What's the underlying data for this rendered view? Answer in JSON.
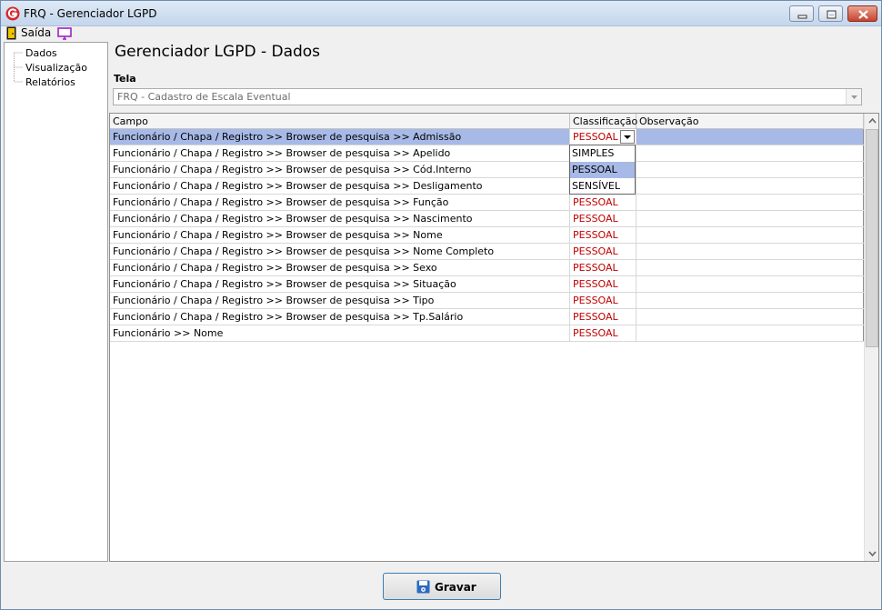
{
  "window": {
    "title": "FRQ - Gerenciador LGPD"
  },
  "menu": {
    "exit_label": "Saída"
  },
  "sidebar": {
    "items": [
      {
        "label": "Dados"
      },
      {
        "label": "Visualização"
      },
      {
        "label": "Relatórios"
      }
    ]
  },
  "page": {
    "title": "Gerenciador LGPD - Dados"
  },
  "tela": {
    "label": "Tela",
    "value": "FRQ - Cadastro de Escala Eventual"
  },
  "grid": {
    "columns": [
      "Campo",
      "Classificação",
      "Observação"
    ],
    "rows": [
      {
        "campo": "Funcionário / Chapa / Registro >> Browser de pesquisa >> Admissão",
        "classificacao": "PESSOAL",
        "observacao": ""
      },
      {
        "campo": "Funcionário / Chapa / Registro >> Browser de pesquisa >> Apelido",
        "classificacao": "",
        "observacao": ""
      },
      {
        "campo": "Funcionário / Chapa / Registro >> Browser de pesquisa >> Cód.Interno",
        "classificacao": "",
        "observacao": ""
      },
      {
        "campo": "Funcionário / Chapa / Registro >> Browser de pesquisa >> Desligamento",
        "classificacao": "",
        "observacao": ""
      },
      {
        "campo": "Funcionário / Chapa / Registro >> Browser de pesquisa >> Função",
        "classificacao": "PESSOAL",
        "observacao": ""
      },
      {
        "campo": "Funcionário / Chapa / Registro >> Browser de pesquisa >> Nascimento",
        "classificacao": "PESSOAL",
        "observacao": ""
      },
      {
        "campo": "Funcionário / Chapa / Registro >> Browser de pesquisa >> Nome",
        "classificacao": "PESSOAL",
        "observacao": ""
      },
      {
        "campo": "Funcionário / Chapa / Registro >> Browser de pesquisa >> Nome Completo",
        "classificacao": "PESSOAL",
        "observacao": ""
      },
      {
        "campo": "Funcionário / Chapa / Registro >> Browser de pesquisa >> Sexo",
        "classificacao": "PESSOAL",
        "observacao": ""
      },
      {
        "campo": "Funcionário / Chapa / Registro >> Browser de pesquisa >> Situação",
        "classificacao": "PESSOAL",
        "observacao": ""
      },
      {
        "campo": "Funcionário / Chapa / Registro >> Browser de pesquisa >> Tipo",
        "classificacao": "PESSOAL",
        "observacao": ""
      },
      {
        "campo": "Funcionário / Chapa / Registro >> Browser de pesquisa >> Tp.Salário",
        "classificacao": "PESSOAL",
        "observacao": ""
      },
      {
        "campo": "Funcionário >> Nome",
        "classificacao": "PESSOAL",
        "observacao": ""
      }
    ]
  },
  "dropdown": {
    "options": [
      "SIMPLES",
      "PESSOAL",
      "SENSÍVEL"
    ],
    "highlighted": "PESSOAL"
  },
  "actions": {
    "save_label": "Gravar"
  },
  "colors": {
    "selection": "#a7b9e6",
    "classification_text": "#c00000",
    "logo": "#d7262c"
  },
  "icons": [
    "app-logo-icon",
    "exit-door-icon",
    "monitor-icon",
    "save-disk-icon",
    "chevron-down-icon"
  ]
}
